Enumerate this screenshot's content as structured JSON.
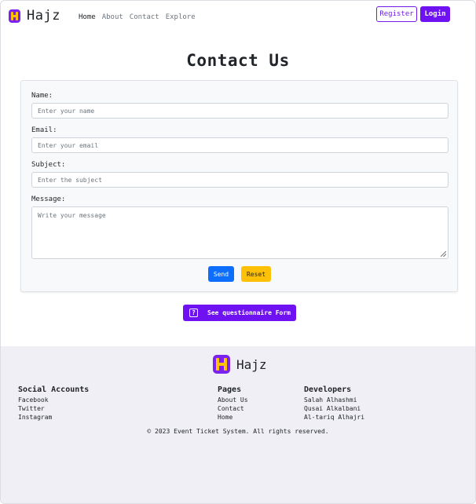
{
  "brand": {
    "name": "Hajz",
    "logo_icon": "hajz-logo-icon",
    "logo_color": "#7b22f0",
    "logo_accent": "#ffc107"
  },
  "nav": {
    "links": [
      "Home",
      "About",
      "Contact",
      "Explore"
    ],
    "register_label": "Register",
    "login_label": "Login"
  },
  "page_title": "Contact Us",
  "form": {
    "name_label": "Name:",
    "name_placeholder": "Enter your name",
    "email_label": "Email:",
    "email_placeholder": "Enter your email",
    "subject_label": "Subject:",
    "subject_placeholder": "Enter the subject",
    "message_label": "Message:",
    "message_placeholder": "Write your message",
    "send_label": "Send",
    "reset_label": "Reset"
  },
  "questionnaire": {
    "label": "See questionnaire Form",
    "icon": "question-icon",
    "icon_glyph": "?"
  },
  "footer": {
    "brand_name": "Hajz",
    "social": {
      "title": "Social Accounts",
      "items": [
        "Facebook",
        "Twitter",
        "Instagram"
      ]
    },
    "pages": {
      "title": "Pages",
      "items": [
        "About Us",
        "Contact",
        "Home"
      ]
    },
    "developers": {
      "title": "Developers",
      "items": [
        "Salah Alhashmi",
        "Qusai Alkalbani",
        "Al-tariq Alhajri"
      ]
    },
    "copyright": "© 2023 Event Ticket System. All rights reserved."
  },
  "colors": {
    "primary": "#6f12f2",
    "send": "#0d6efd",
    "reset": "#ffc107",
    "footer_bg": "#efeff5"
  }
}
